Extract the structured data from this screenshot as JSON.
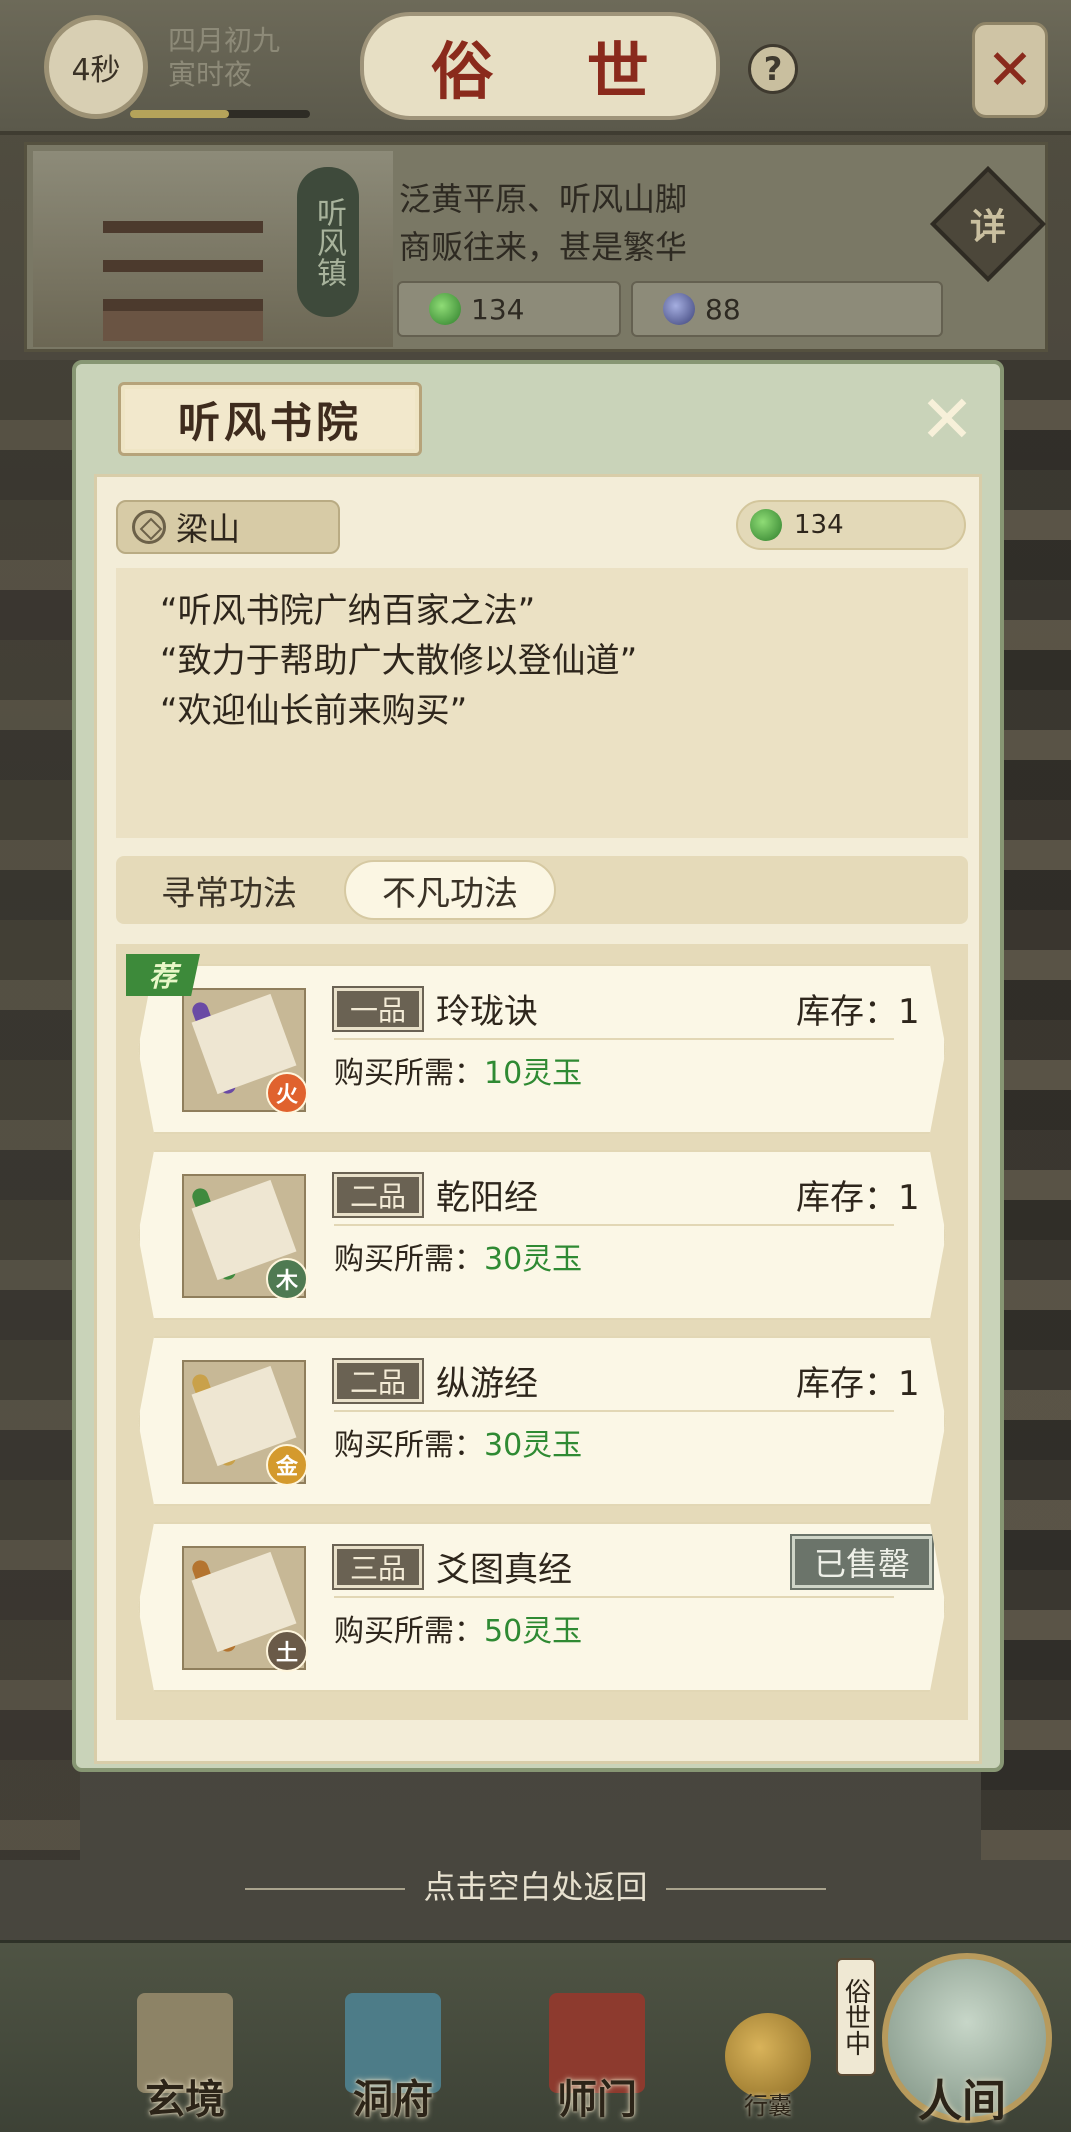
{
  "header": {
    "timer": "4秒",
    "lunar_date": "四月初九",
    "time_period": "寅时夜",
    "time_progress": 0.55,
    "title": "俗 世",
    "help_icon": "question-icon",
    "close_icon": "crossed-swords-icon"
  },
  "location": {
    "name": "听风镇",
    "desc_line1": "泛黄平原、听风山脚",
    "desc_line2": "商贩往来，甚是繁华",
    "jade": "134",
    "coins": "88",
    "detail_label": "详"
  },
  "shop": {
    "title": "听风书院",
    "npc": "梁山",
    "jade_balance": "134",
    "quotes": [
      "“听风书院广纳百家之法”",
      "“致力于帮助广大散修以登仙道”",
      "“欢迎仙长前来购买”"
    ],
    "tabs": [
      "寻常功法",
      "不凡功法"
    ],
    "active_tab": "不凡功法",
    "price_prefix": "购买所需：",
    "stock_prefix": "库存：",
    "recommend_badge": "荐",
    "items": [
      {
        "grade": "一品",
        "name": "玲珑诀",
        "element": "火",
        "element_color": "#e0622e",
        "rod_color": "#6a4aa5",
        "price": "10灵玉",
        "stock": "1",
        "sold_out": false,
        "recommended": true
      },
      {
        "grade": "二品",
        "name": "乾阳经",
        "element": "木",
        "element_color": "#4f7a52",
        "rod_color": "#3f8a3e",
        "price": "30灵玉",
        "stock": "1",
        "sold_out": false,
        "recommended": false
      },
      {
        "grade": "二品",
        "name": "纵游经",
        "element": "金",
        "element_color": "#d49a2d",
        "rod_color": "#c9a14a",
        "price": "30灵玉",
        "stock": "1",
        "sold_out": false,
        "recommended": false
      },
      {
        "grade": "三品",
        "name": "爻图真经",
        "element": "土",
        "element_color": "#6a5a48",
        "rod_color": "#b4742f",
        "price": "50灵玉",
        "stock": "",
        "sold_out": true,
        "sold_out_label": "已售罄",
        "recommended": false
      }
    ],
    "return_hint": "点击空白处返回"
  },
  "nav": {
    "items": [
      "玄境",
      "洞府",
      "师门"
    ],
    "bag": "行囊",
    "in_world": "俗世中",
    "human": "人间"
  }
}
